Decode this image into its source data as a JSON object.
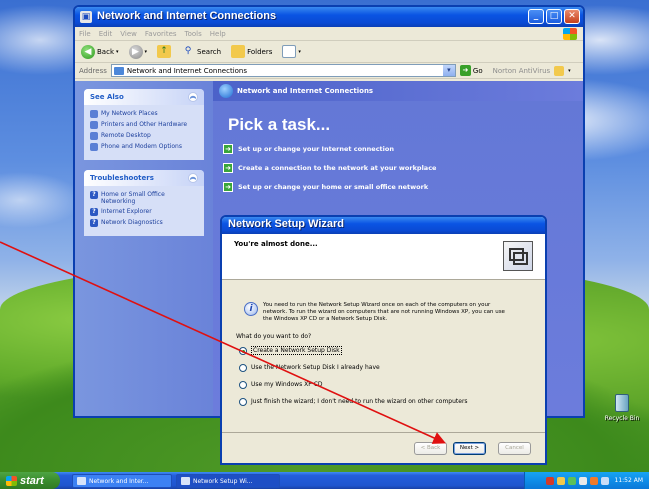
{
  "explorer": {
    "title": "Network and Internet Connections",
    "menu": [
      "File",
      "Edit",
      "View",
      "Favorites",
      "Tools",
      "Help"
    ],
    "toolbar": {
      "back": "Back",
      "search": "Search",
      "folders": "Folders"
    },
    "address": {
      "label": "Address",
      "value": "Network and Internet Connections",
      "go": "Go",
      "norton": "Norton AntiVirus"
    },
    "see_also": {
      "heading": "See Also",
      "items": [
        "My Network Places",
        "Printers and Other Hardware",
        "Remote Desktop",
        "Phone and Modem Options"
      ]
    },
    "troubleshooters": {
      "heading": "Troubleshooters",
      "items": [
        "Home or Small Office Networking",
        "Internet Explorer",
        "Network Diagnostics"
      ]
    },
    "banner": "Network and Internet Connections",
    "pick_title": "Pick a task...",
    "tasks": [
      "Set up or change your Internet connection",
      "Create a connection to the network at your workplace",
      "Set up or change your home or small office network"
    ]
  },
  "wizard": {
    "title": "Network Setup Wizard",
    "heading": "You're almost done...",
    "info": "You need to run the Network Setup Wizard once on each of the computers on your network. To run the wizard on computers that are not running Windows XP, you can use the Windows XP CD or a Network Setup Disk.",
    "question": "What do you want to do?",
    "options": [
      "Create a Network Setup Disk",
      "Use the Network Setup Disk I already have",
      "Use my Windows XP CD",
      "Just finish the wizard; I don't need to run the wizard on other computers"
    ],
    "selected_index": 0,
    "buttons": {
      "back": "< Back",
      "next": "Next >",
      "cancel": "Cancel"
    }
  },
  "desktop": {
    "recycle_bin": "Recycle Bin"
  },
  "taskbar": {
    "start": "start",
    "buttons": [
      "Network and Inter...",
      "Network Setup Wi..."
    ],
    "clock": "11:52 AM"
  },
  "annotation": {
    "color": "#e01010"
  }
}
